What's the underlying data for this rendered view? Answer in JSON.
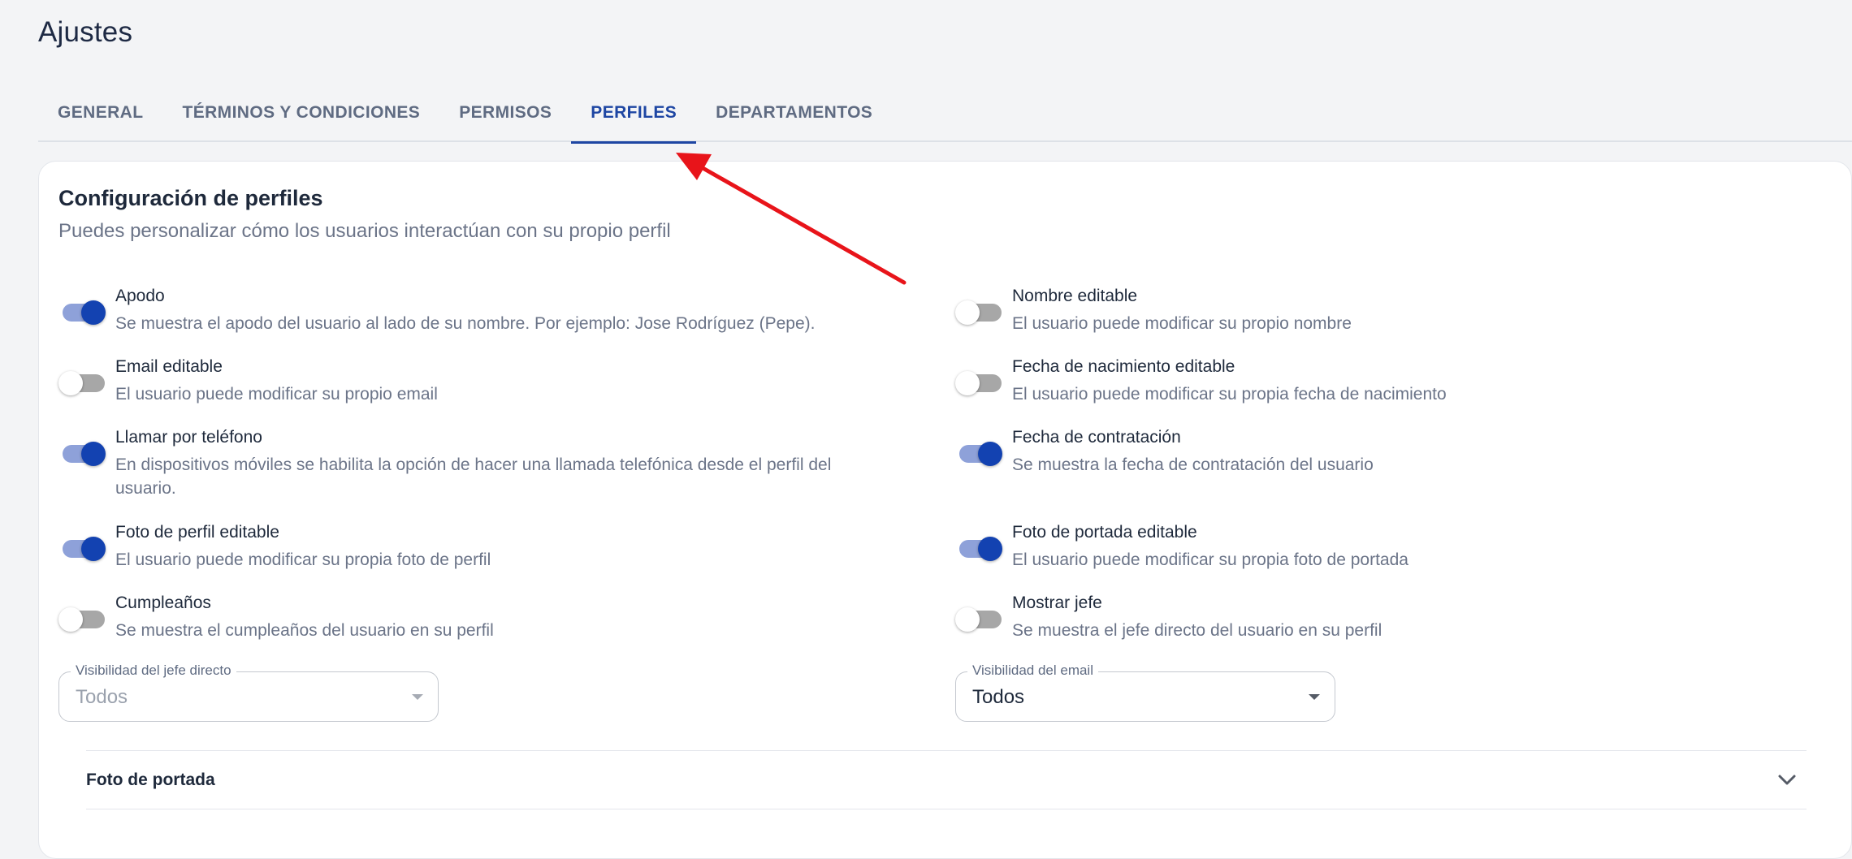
{
  "page": {
    "title": "Ajustes"
  },
  "tabs": [
    {
      "label": "GENERAL",
      "active": false
    },
    {
      "label": "TÉRMINOS Y CONDICIONES",
      "active": false
    },
    {
      "label": "PERMISOS",
      "active": false
    },
    {
      "label": "PERFILES",
      "active": true
    },
    {
      "label": "DEPARTAMENTOS",
      "active": false
    }
  ],
  "section": {
    "title": "Configuración de perfiles",
    "subtitle": "Puedes personalizar cómo los usuarios interactúan con su propio perfil"
  },
  "settings": {
    "left": [
      {
        "label": "Apodo",
        "description": "Se muestra el apodo del usuario al lado de su nombre. Por ejemplo: Jose Rodríguez (Pepe).",
        "enabled": true
      },
      {
        "label": "Email editable",
        "description": "El usuario puede modificar su propio email",
        "enabled": false
      },
      {
        "label": "Llamar por teléfono",
        "description": "En dispositivos móviles se habilita la opción de hacer una llamada telefónica desde el perfil del usuario.",
        "enabled": true
      },
      {
        "label": "Foto de perfil editable",
        "description": "El usuario puede modificar su propia foto de perfil",
        "enabled": true
      },
      {
        "label": "Cumpleaños",
        "description": "Se muestra el cumpleaños del usuario en su perfil",
        "enabled": false
      }
    ],
    "right": [
      {
        "label": "Nombre editable",
        "description": "El usuario puede modificar su propio nombre",
        "enabled": false
      },
      {
        "label": "Fecha de nacimiento editable",
        "description": "El usuario puede modificar su propia fecha de nacimiento",
        "enabled": false
      },
      {
        "label": "Fecha de contratación",
        "description": "Se muestra la fecha de contratación del usuario",
        "enabled": true
      },
      {
        "label": "Foto de portada editable",
        "description": "El usuario puede modificar su propia foto de portada",
        "enabled": true
      },
      {
        "label": "Mostrar jefe",
        "description": "Se muestra el jefe directo del usuario en su perfil",
        "enabled": false
      }
    ]
  },
  "selects": {
    "boss_visibility": {
      "label": "Visibilidad del jefe directo",
      "value": "Todos",
      "disabled": true
    },
    "email_visibility": {
      "label": "Visibilidad del email",
      "value": "Todos",
      "disabled": false
    }
  },
  "accordion": {
    "title": "Foto de portada"
  },
  "colors": {
    "accent": "#1e46a3",
    "toggle_on_thumb": "#1342b1",
    "toggle_on_track": "#8ea1d9",
    "toggle_off_track": "#a7a7a7",
    "annotation_arrow": "#e8141a"
  },
  "icons": {
    "select_caret": "caret-down-icon",
    "accordion_chevron": "chevron-down-icon",
    "annotation": "red-arrow-annotation"
  }
}
